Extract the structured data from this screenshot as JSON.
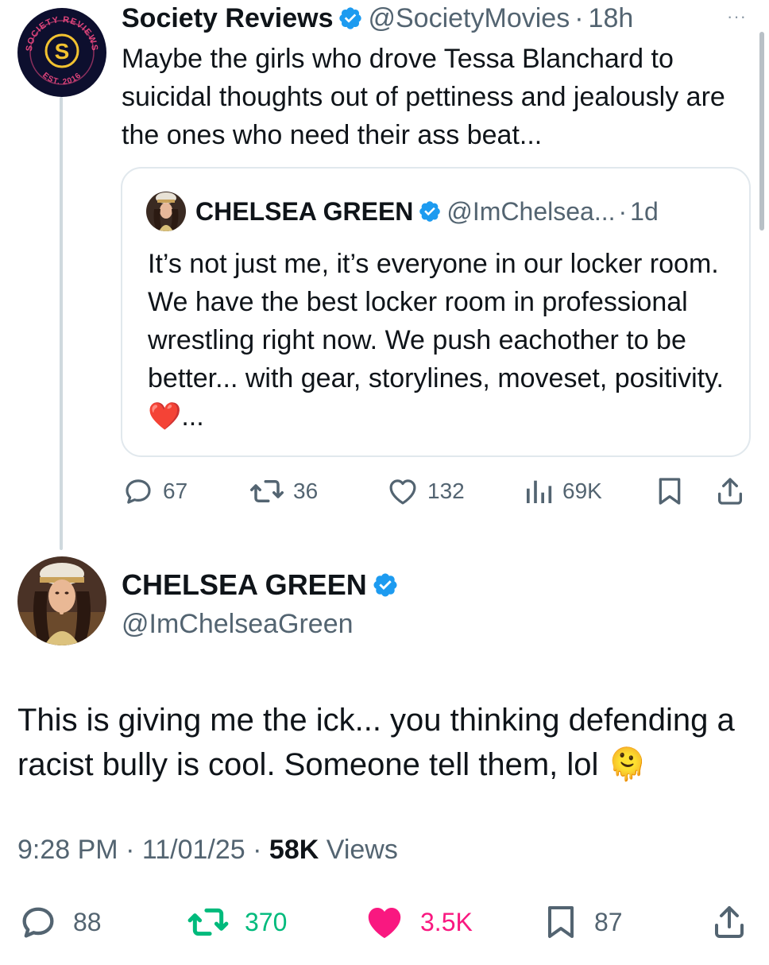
{
  "original_tweet": {
    "author_name": "Society Reviews",
    "author_handle": "@SocietyMovies",
    "time": "18h",
    "separator": "·",
    "avatar_badge_letter": "S",
    "avatar_text_top": "SOCIETY REVIEWS",
    "avatar_text_bottom": "EST. 2016",
    "more_label": "···",
    "text": "Maybe the girls who drove Tessa Blanchard to suicidal thoughts out of pettiness and jealously are the ones who need their ass beat...",
    "quote": {
      "author_name": "CHELSEA GREEN",
      "author_handle": "@ImChelsea...",
      "time": "1d",
      "separator": "·",
      "text": "It’s not just me, it’s everyone in our locker room. We have the best locker room in professional wrestling right now. We push eachother to be better... with gear, storylines, moveset, positivity. ❤️..."
    },
    "stats": {
      "replies": "67",
      "reposts": "36",
      "likes": "132",
      "views": "69K"
    }
  },
  "reply_tweet": {
    "author_name": "CHELSEA GREEN",
    "author_handle": "@ImChelseaGreen",
    "text": "This is giving me the ick... you thinking defending a racist bully is cool. Someone tell them, lol 🫠",
    "time": "9:28 PM",
    "date": "11/01/25",
    "separator": "·",
    "views_count": "58K",
    "views_label": "Views",
    "stats": {
      "replies": "88",
      "reposts": "370",
      "likes": "3.5K",
      "bookmarks": "87"
    }
  },
  "colors": {
    "verified_blue": "#1d9bf0",
    "text_primary": "#0f1419",
    "text_secondary": "#536471",
    "repost_green": "#00ba7c",
    "like_pink": "#f91880",
    "border": "#e1e8ed"
  },
  "icons": [
    "reply-icon",
    "repost-icon",
    "like-icon",
    "views-icon",
    "bookmark-icon",
    "share-icon",
    "verified-icon",
    "more-icon"
  ]
}
